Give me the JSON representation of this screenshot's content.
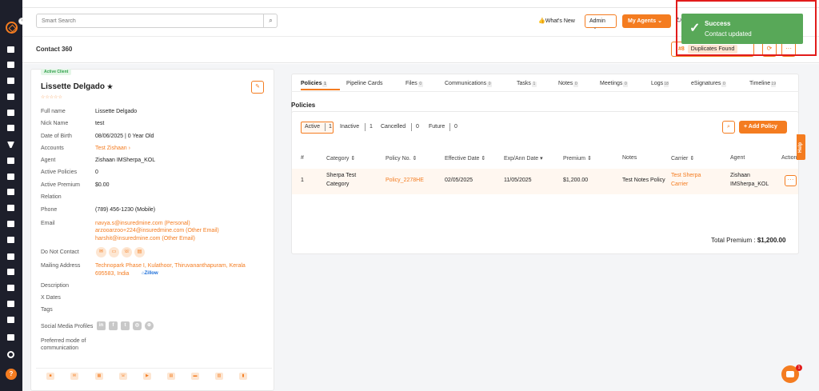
{
  "sidebar": {
    "icons": [
      "dashboard-icon",
      "contacts-icon",
      "documents-icon",
      "carriers-icon",
      "reports-icon",
      "id-card-icon",
      "filter-icon",
      "megaphone-icon",
      "user-icon",
      "analytics-icon",
      "folder-icon",
      "calculator-icon",
      "calendar-icon",
      "mail-icon",
      "announce-icon",
      "workflow-icon",
      "trend-icon",
      "integrations-icon",
      "settings-icon"
    ],
    "help_label": "?"
  },
  "topbar": {
    "search_placeholder": "Smart Search",
    "whats_new": "What's New",
    "admin_label": "Admin",
    "agents_label": "My Agents"
  },
  "header": {
    "title": "Contact 360",
    "duplicates_count": "#8",
    "duplicates_label": "Duplicates Found"
  },
  "contact": {
    "badge": "Active Client",
    "name": "Lissette Delgado",
    "star": "★",
    "rating_stars": "☆☆☆☆☆",
    "fields": [
      {
        "label": "Full name",
        "value": "Lissette Delgado"
      },
      {
        "label": "Nick Name",
        "value": "test"
      },
      {
        "label": "Date of Birth",
        "value": "08/06/2025 | 0 Year Old"
      },
      {
        "label": "Accounts",
        "value": "Test Zishaan ›"
      },
      {
        "label": "Agent",
        "value": "Zishaan IMSherpa_KOL"
      },
      {
        "label": "Active Policies",
        "value": "0"
      },
      {
        "label": "Active Premium",
        "value": "$0.00"
      },
      {
        "label": "Relation",
        "value": ""
      },
      {
        "label": "Phone",
        "value": "(789) 456-1230 (Mobile)"
      }
    ],
    "email_label": "Email",
    "emails": [
      "navya.s@insuredmine.com  (Personal)",
      "arzooarzoo+224@insuredmine.com  (Other Email)",
      "harshit@insuredmine.com  (Other Email)"
    ],
    "dnc_label": "Do Not Contact",
    "mailing_label": "Mailing Address",
    "mailing_line1": "Technopark Phase I, Kulathoor, Thiruvananthapuram, Kerala",
    "mailing_line2": "695583, India",
    "zillow": "Zillow",
    "description_label": "Description",
    "xdates_label": "X Dates",
    "tags_label": "Tags",
    "social_label": "Social Media Profiles",
    "pref_label_1": "Preferred mode of",
    "pref_label_2": "communication"
  },
  "tabs": [
    {
      "label": "Policies",
      "count": "1"
    },
    {
      "label": "Pipeline Cards",
      "count": ""
    },
    {
      "label": "Files",
      "count": "0"
    },
    {
      "label": "Communications",
      "count": "0"
    },
    {
      "label": "Tasks",
      "count": "1"
    },
    {
      "label": "Notes",
      "count": "0"
    },
    {
      "label": "Meetings",
      "count": "0"
    },
    {
      "label": "Logs",
      "count": "18"
    },
    {
      "label": "eSignatures",
      "count": "0"
    },
    {
      "label": "Timeline",
      "count": "19"
    }
  ],
  "policies": {
    "heading": "Policies",
    "filters": [
      {
        "label": "Active",
        "count": "1"
      },
      {
        "label": "Inactive",
        "count": "1"
      },
      {
        "label": "Cancelled",
        "count": "0"
      },
      {
        "label": "Future",
        "count": "0"
      }
    ],
    "add_label": "+ Add Policy",
    "columns": [
      "#",
      "Category ⇕",
      "Policy No. ⇕",
      "Effective Date ⇕",
      "Exp/Ann Date ▾",
      "Premium ⇕",
      "Notes",
      "Carrier ⇕",
      "Agent",
      "Action"
    ],
    "row": {
      "num": "1",
      "category_1": "Sherpa Test",
      "category_2": "Category",
      "policy_no": "Policy_2278HE",
      "effective": "02/05/2025",
      "expiry": "11/05/2025",
      "premium": "$1,200.00",
      "notes": "Test Notes Policy",
      "carrier_1": "Test Sherpa",
      "carrier_2": "Carrier",
      "agent_1": "Zishaan",
      "agent_2": "IMSherpa_KOL",
      "action": "···"
    },
    "total_label": "Total Premium :",
    "total_value": "$1,200.00"
  },
  "toast": {
    "title": "Success",
    "message": "Contact updated"
  },
  "help_tab": "Help",
  "chat_badge": "1",
  "colors": {
    "accent": "#f47c20",
    "sidebar": "#1d1f2b",
    "success": "#58a858",
    "highlight": "#e21b1b"
  }
}
